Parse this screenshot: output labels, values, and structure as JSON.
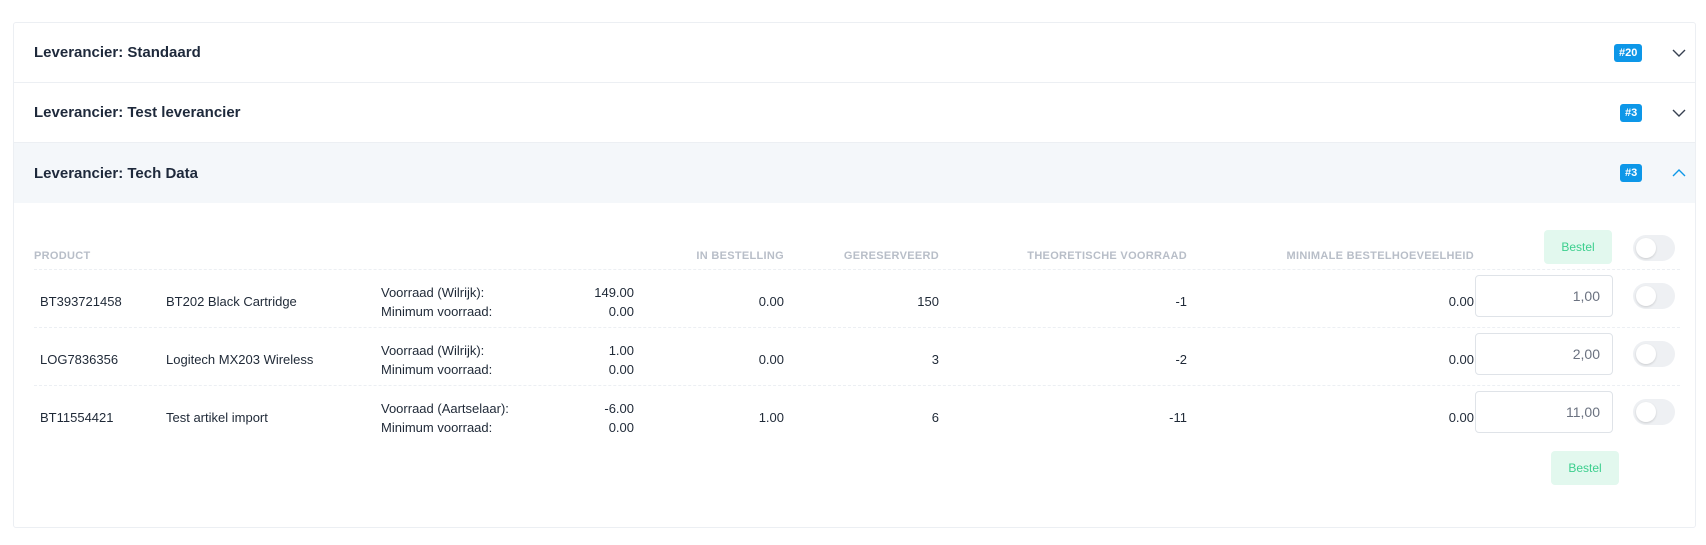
{
  "suppliers": [
    {
      "title": "Leverancier: Standaard",
      "badge": "#20",
      "expanded": false
    },
    {
      "title": "Leverancier: Test leverancier",
      "badge": "#3",
      "expanded": false
    },
    {
      "title": "Leverancier: Tech Data",
      "badge": "#3",
      "expanded": true
    }
  ],
  "table": {
    "headers": {
      "product": "PRODUCT",
      "in_order": "IN BESTELLING",
      "reserved": "GERESERVEERD",
      "theoretical_stock": "THEORETISCHE VOORRAAD",
      "min_order_qty": "MINIMALE BESTELHOEVEELHEID"
    },
    "order_button_label": "Bestel",
    "rows": [
      {
        "code": "BT393721458",
        "name": "BT202 Black Cartridge",
        "stock_label": "Voorraad (Wilrijk):",
        "stock": "149.00",
        "min_label": "Minimum voorraad:",
        "min": "0.00",
        "in_order": "0.00",
        "reserved": "150",
        "theoretical": "-1",
        "min_order_qty": "0.00",
        "qty": "1,00"
      },
      {
        "code": "LOG7836356",
        "name": "Logitech MX203 Wireless",
        "stock_label": "Voorraad (Wilrijk):",
        "stock": "1.00",
        "min_label": "Minimum voorraad:",
        "min": "0.00",
        "in_order": "0.00",
        "reserved": "3",
        "theoretical": "-2",
        "min_order_qty": "0.00",
        "qty": "2,00"
      },
      {
        "code": "BT11554421",
        "name": "Test artikel import",
        "stock_label": "Voorraad (Aartselaar):",
        "stock": "-6.00",
        "min_label": "Minimum voorraad:",
        "min": "0.00",
        "in_order": "1.00",
        "reserved": "6",
        "theoretical": "-11",
        "min_order_qty": "0.00",
        "qty": "11,00"
      }
    ]
  },
  "colors": {
    "badge": "#0d97e8",
    "bestel_bg": "#e2f8ee",
    "bestel_text": "#3ccf8e",
    "open_header_bg": "#f4f7fa"
  },
  "icons": {
    "collapsed": "chevron-down-icon",
    "expanded": "chevron-up-icon"
  }
}
